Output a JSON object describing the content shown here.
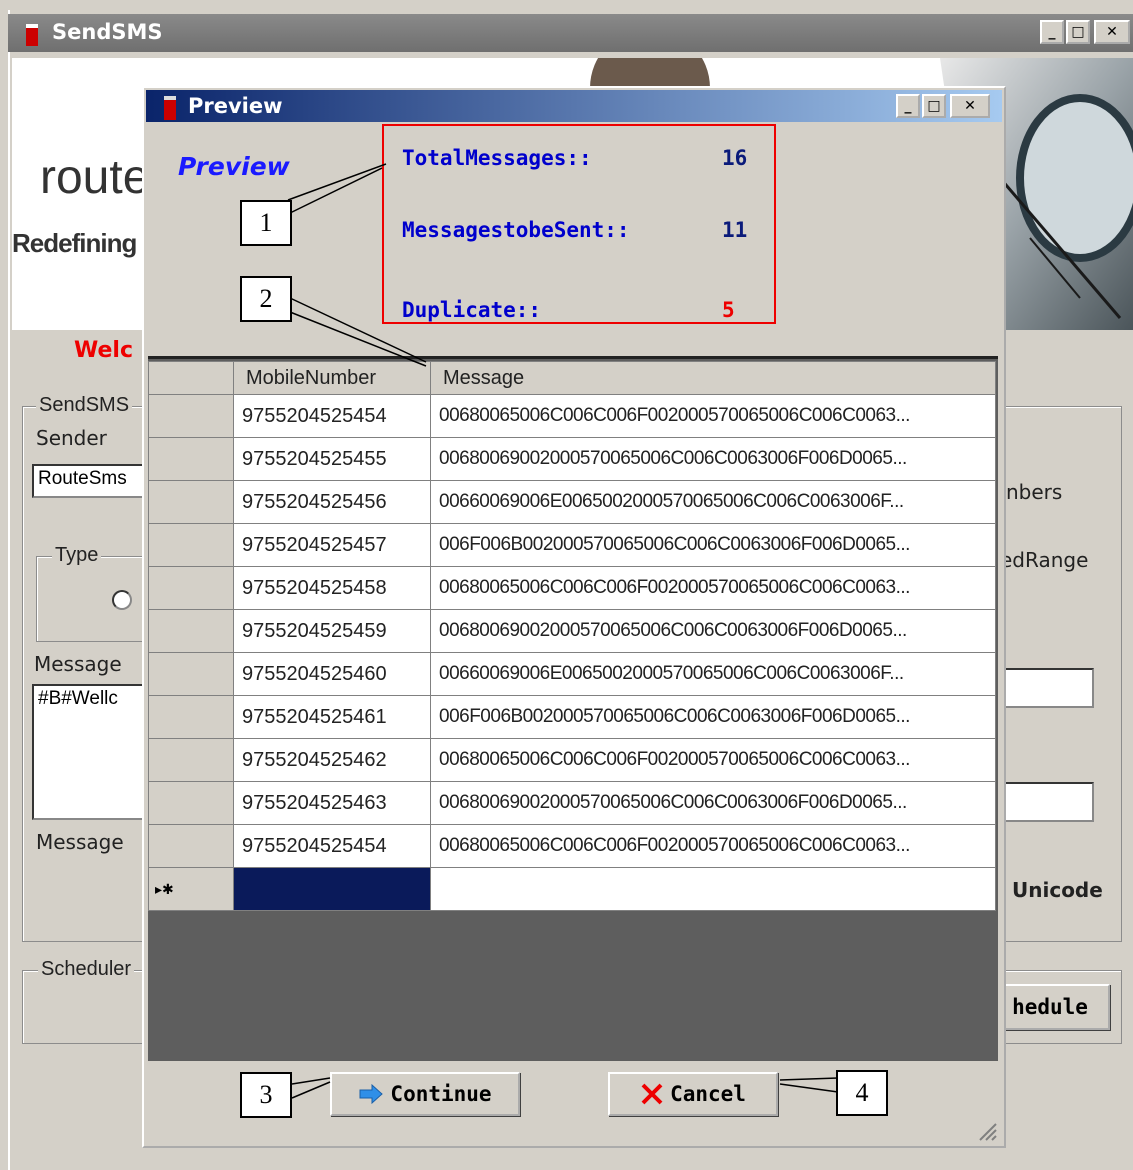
{
  "main_window": {
    "title": "SendSMS",
    "logo_text": "route",
    "tagline": "Redefining",
    "welcome": "Welc",
    "send_sms_group": "Send SMS",
    "sender_label": "Sender",
    "sender_value": "RouteSms",
    "type_group": "Type",
    "message_label": "Message",
    "message_value": "#B# Wellc",
    "message_label2": "Message",
    "scheduler_group": "Scheduler",
    "numbers_text": "nbers",
    "range_text": "ed Range",
    "unicode_text": "Unicode",
    "schedule_button": "hedule"
  },
  "preview": {
    "title": "Preview",
    "heading": "Preview",
    "stats": {
      "total_label": "Total Messages::",
      "total_value": "16",
      "to_send_label": "Messages to be Sent::",
      "to_send_value": "11",
      "duplicate_label": "Duplicate::",
      "duplicate_value": "5"
    },
    "columns": [
      "MobileNumber",
      "Message"
    ],
    "rows": [
      {
        "number": "9755204525454",
        "message": "00680065006C006C006F002000570065006C006C0063..."
      },
      {
        "number": "9755204525455",
        "message": "0068006900200057006500 6C006C0063006F006D0065..."
      },
      {
        "number": "9755204525456",
        "message": "00660069006E006500200057006500 6C006C0063006F..."
      },
      {
        "number": "9755204525457",
        "message": "006F006B002000570065006C006C0063006F006D0065..."
      },
      {
        "number": "9755204525458",
        "message": "00680065006C006C006F002000570065006C006C0063..."
      },
      {
        "number": "9755204525459",
        "message": "0068006900200057006500 6C006C0063006F006D0065..."
      },
      {
        "number": "9755204525460",
        "message": "00660069006E006500200057006500 6C006C0063006F..."
      },
      {
        "number": "9755204525461",
        "message": "006F006B002000570065006C006C0063006F006D0065..."
      },
      {
        "number": "9755204525462",
        "message": "00680065006C006C006F002000570065006C006C0063..."
      },
      {
        "number": "9755204525463",
        "message": "0068006900200057006500 6C006C0063006F006D0065..."
      },
      {
        "number": "9755204525454",
        "message": "00680065006C006C006F002000570065006C006C0063..."
      }
    ],
    "new_row_marker": "▸✱",
    "continue_button": "Continue",
    "cancel_button": "Cancel"
  },
  "callouts": [
    "1",
    "2",
    "3",
    "4"
  ],
  "colors": {
    "title_gradient_start": "#0a246a",
    "title_gradient_end": "#a6caf0",
    "stats_border": "#e00000",
    "stats_label": "#0000cc",
    "duplicate_value": "#e00000",
    "selection": "#0a1a5a"
  }
}
